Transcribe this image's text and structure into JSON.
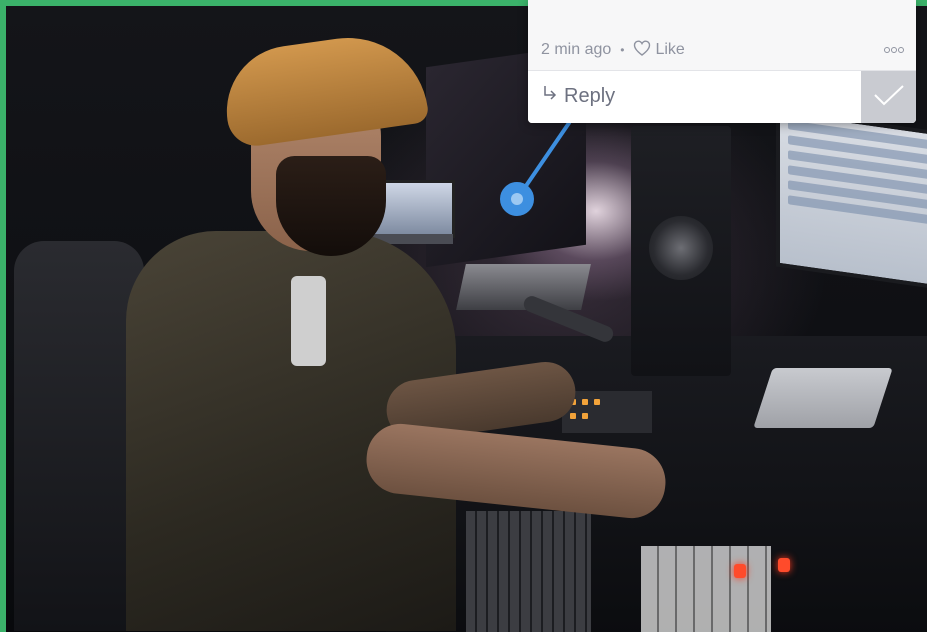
{
  "comment": {
    "timestamp": "2 min ago",
    "separator": "•",
    "like_label": "Like",
    "reply_label": "Reply",
    "icons": {
      "like": "heart-outline-icon",
      "more": "three-circles-more-icon",
      "reply": "reply-arrow-icon",
      "resolve": "checkmark-icon"
    }
  },
  "colors": {
    "frame_border": "#3bb26a",
    "pin": "#3d8fe0",
    "card_background": "#f7f7f8",
    "muted_text": "#8f93a0",
    "resolve_button": "#c9cbd1"
  }
}
